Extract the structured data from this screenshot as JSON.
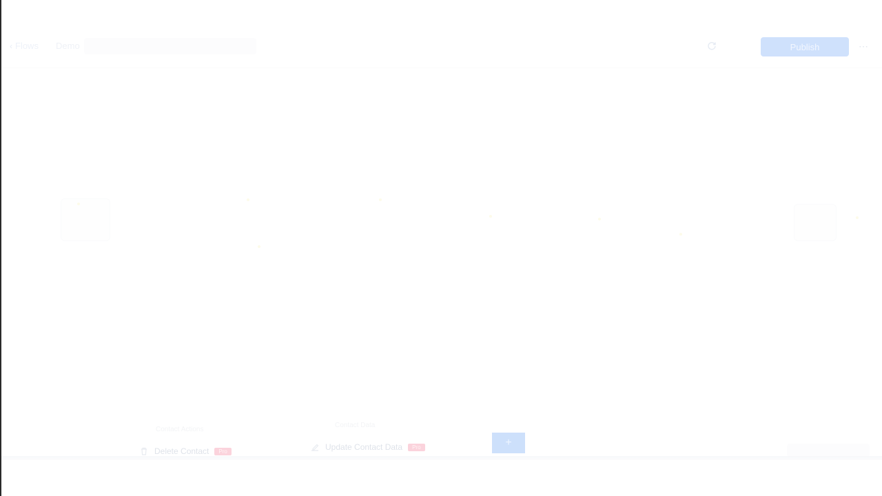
{
  "header": {
    "back_label": "Flows",
    "flow_name": "Demo",
    "publish_label": "Publish",
    "more_glyph": "⋯",
    "back_glyph": "‹"
  },
  "tray": {
    "group_label_left": "Contact Actions",
    "group_label_mid": "Contact Data",
    "items": [
      {
        "label": "Delete Contact",
        "badge": "Pro",
        "icon": "trash-icon"
      },
      {
        "label": "Update Contact Data",
        "badge": "Pro",
        "icon": "edit-icon"
      }
    ],
    "add_glyph": "+"
  },
  "colors": {
    "accent": "#cfe1fc",
    "badge": "#fbd3dc",
    "border": "#2a2a2a"
  }
}
